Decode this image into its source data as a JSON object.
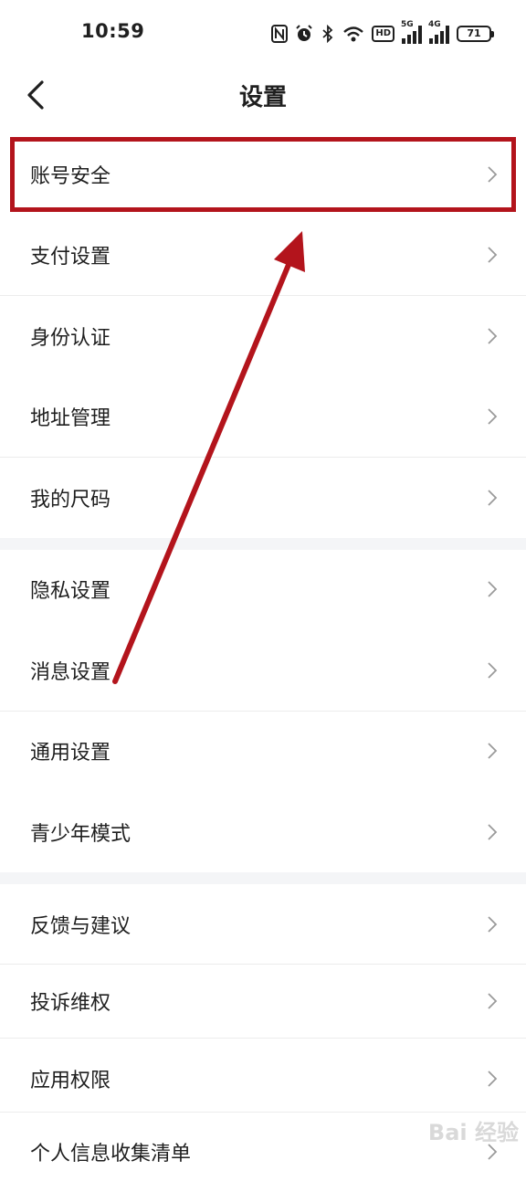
{
  "status": {
    "time": "10:59",
    "net1": "5G",
    "net2": "4G",
    "hd": "HD",
    "battery": "71",
    "icons": [
      "nfc-icon",
      "alarm-icon",
      "bluetooth-icon",
      "wifi-icon",
      "hd-icon",
      "signal-5g-icon",
      "signal-4g-icon",
      "battery-icon"
    ]
  },
  "header": {
    "title": "设置",
    "back_icon": "back-arrow-icon"
  },
  "items": [
    {
      "label": "账号安全"
    },
    {
      "label": "支付设置"
    },
    {
      "label": "身份认证"
    },
    {
      "label": "地址管理"
    },
    {
      "label": "我的尺码"
    },
    {
      "label": "隐私设置"
    },
    {
      "label": "消息设置"
    },
    {
      "label": "通用设置"
    },
    {
      "label": "青少年模式"
    },
    {
      "label": "反馈与建议"
    },
    {
      "label": "投诉维权"
    },
    {
      "label": "应用权限"
    },
    {
      "label": "个人信息收集清单"
    }
  ],
  "annotation": {
    "color": "#b3141c",
    "highlight_item": "账号安全"
  },
  "watermark": "Bai 经验"
}
